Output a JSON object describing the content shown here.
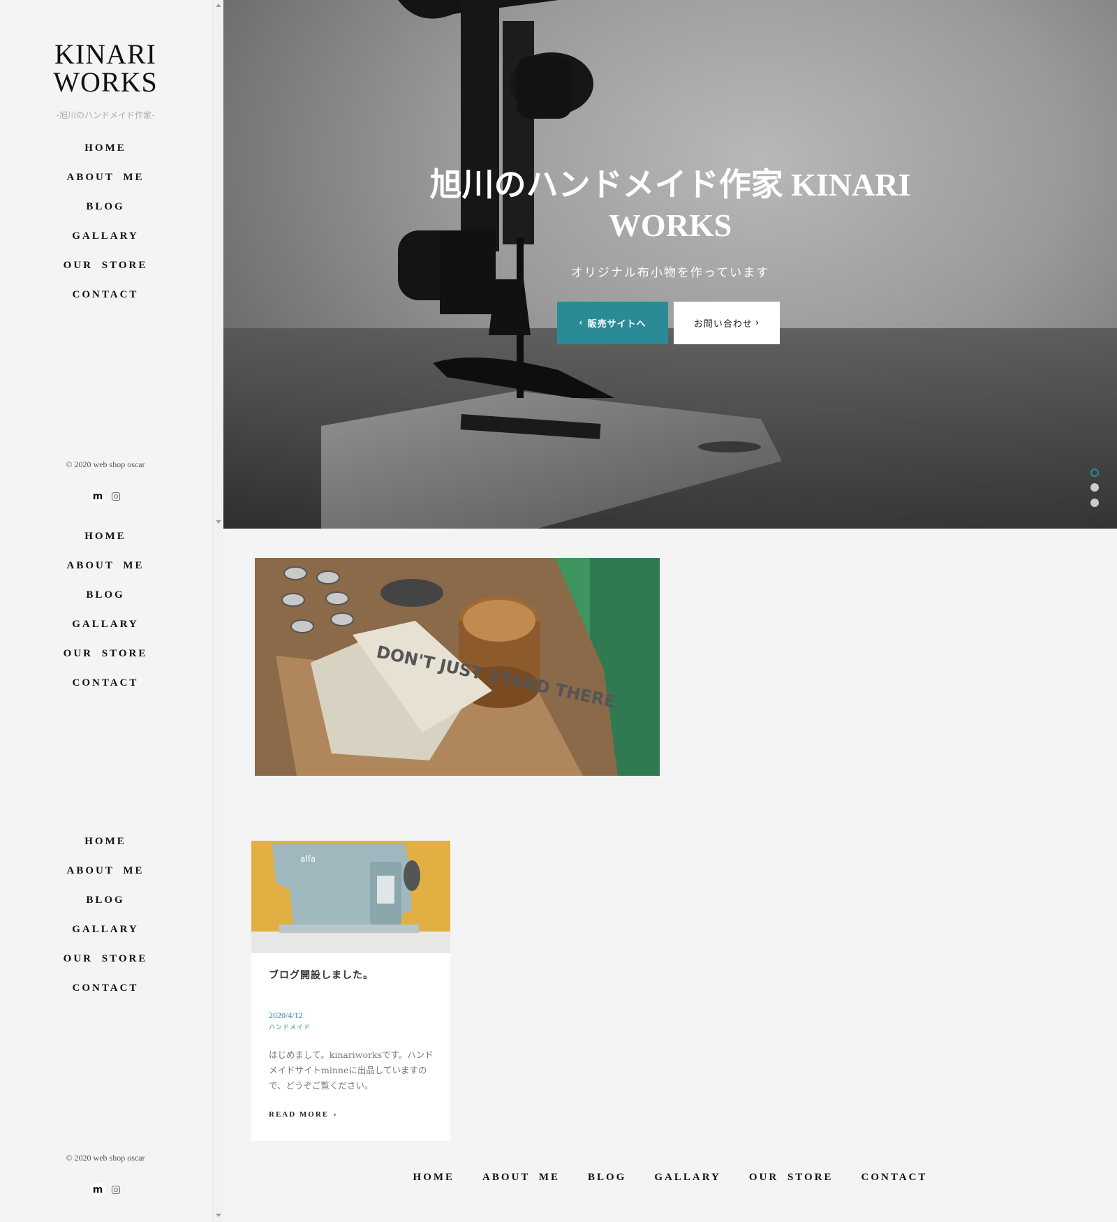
{
  "site": {
    "logo_line1": "KINARI",
    "logo_line2": "WORKS",
    "tagline": "-旭川のハンドメイド作家-"
  },
  "nav": [
    "HOME",
    "ABOUT ME",
    "BLOG",
    "GALLARY",
    "OUR STORE",
    "CONTACT"
  ],
  "copyright": "© 2020 web shop oscar",
  "social": {
    "minne": "m",
    "instagram": "instagram-icon"
  },
  "hero": {
    "title": "旭川のハンドメイド作家 KINARI WORKS",
    "subtitle": "オリジナル布小物を作っています",
    "btn_sell": "販売サイトへ",
    "btn_contact": "お問い合わせ",
    "slides": 3,
    "active_slide": 1
  },
  "feature": {
    "image_text": "DON'T JUST STAND THERE"
  },
  "blog": {
    "title": "ブログ開設しました。",
    "date": "2020/4/12",
    "category": "ハンドメイド",
    "excerpt": "はじめまして。kinariworksです。ハンドメイドサイトminneに出品していますので、どうぞご覧ください。",
    "read_more": "READ MORE",
    "thumb_brand": "alfa"
  },
  "colors": {
    "accent": "#2a8b97",
    "background": "#f4f4f4"
  }
}
